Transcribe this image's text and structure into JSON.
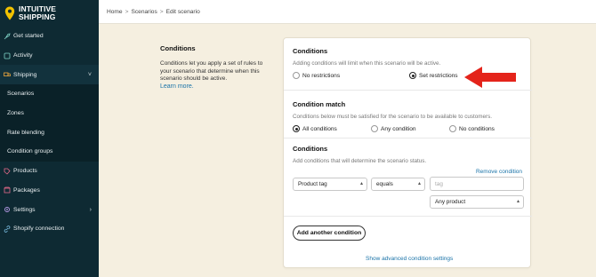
{
  "brand": {
    "line1": "INTUITIVE",
    "line2": "SHIPPING"
  },
  "sidebar": {
    "items": [
      {
        "label": "Get started",
        "icon": "rocket-icon"
      },
      {
        "label": "Activity",
        "icon": "activity-icon"
      },
      {
        "label": "Shipping",
        "icon": "truck-icon",
        "chevron": "˅"
      },
      {
        "label": "Scenarios"
      },
      {
        "label": "Zones"
      },
      {
        "label": "Rate blending"
      },
      {
        "label": "Condition groups"
      },
      {
        "label": "Products",
        "icon": "tag-icon"
      },
      {
        "label": "Packages",
        "icon": "box-icon"
      },
      {
        "label": "Settings",
        "icon": "gear-icon",
        "chevron": "›"
      },
      {
        "label": "Shopify connection",
        "icon": "link-icon"
      }
    ]
  },
  "breadcrumb": {
    "home": "Home",
    "scenarios": "Scenarios",
    "current": "Edit scenario",
    "sep": ">"
  },
  "description": {
    "title": "Conditions",
    "body": "Conditions let you apply a set of rules to your scenario that determine when this scenario should be active.",
    "link": "Learn more."
  },
  "card": {
    "conditions_title": "Conditions",
    "conditions_hint": "Adding conditions will limit when this scenario will be active.",
    "no_restrictions": "No restrictions",
    "set_restrictions": "Set restrictions",
    "match_title": "Condition match",
    "match_hint": "Conditions below must be satisfied for the scenario to be available to customers.",
    "all_conditions": "All conditions",
    "any_condition": "Any condition",
    "no_conditions": "No conditions",
    "conditions2_title": "Conditions",
    "conditions2_hint": "Add conditions that will determine the scenario status.",
    "remove_condition": "Remove condition",
    "field_select": "Product tag",
    "operator_select": "equals",
    "value_placeholder": "tag",
    "scope_select": "Any product",
    "add_button": "Add another condition",
    "advanced_link": "Show advanced condition settings"
  },
  "colors": {
    "sidebar": "#0e2a33",
    "accent_link": "#1a73a8",
    "arrow": "#e4241b",
    "brand_yellow": "#f2c200"
  }
}
